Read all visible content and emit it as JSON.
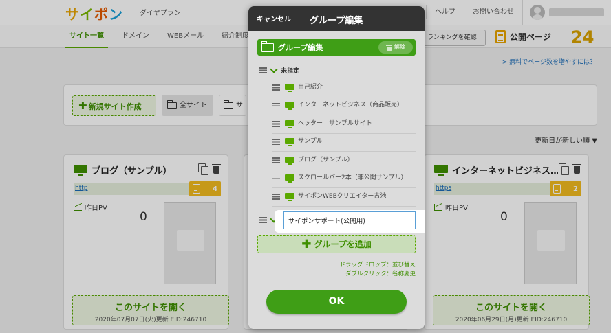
{
  "header": {
    "logo": [
      "サ",
      "イ",
      "ポ",
      "ン"
    ],
    "plan": "ダイヤプラン",
    "links": [
      "ヘルプ",
      "お問い合わせ"
    ]
  },
  "nav": {
    "tabs": [
      "サイト一覧",
      "ドメイン",
      "WEBメール",
      "紹介制度"
    ],
    "ranking_button": "ランキングを確認",
    "public_pages_label": "公開ページ",
    "public_pages_count": "24",
    "more_pages_link": "> 無料でページ数を増やすには？"
  },
  "toolbar": {
    "new_site": "新規サイト作成",
    "all_sites": "全サイト",
    "other": "サ"
  },
  "sort_label": "更新日が新しい順 ▼",
  "cards": [
    {
      "title": "ブログ（サンプル）",
      "url": "http",
      "pages": "4",
      "pv_label": "昨日PV",
      "pv": "0",
      "open_label": "このサイトを開く",
      "updated": "2020年07月07日(火)更新 EID:246710"
    },
    {
      "title": "インターネットビジネス…",
      "url": "https",
      "pages": "2",
      "pv_label": "昨日PV",
      "pv": "0",
      "open_label": "このサイトを開く",
      "updated": "2020年06月29日(月)更新 EID:246710"
    }
  ],
  "modal": {
    "cancel": "キャンセル",
    "title": "グループ編集",
    "group_header": "グループ編集",
    "release": "解除",
    "unassigned_group": "未指定",
    "sites": [
      "自己紹介",
      "インターネットビジネス（商品販売）",
      "ヘッター　サンプルサイト",
      "サンプル",
      "ブログ（サンプル）",
      "スクロールバー2本（非公開サンプル）",
      "サイポンWEBクリエイター古池"
    ],
    "new_group_value": "サイポンサポート(公開用)",
    "add_group": "グループを追加",
    "hint_drag": "ドラッグドロップ：並び替え",
    "hint_dblclick": "ダブルクリック：名称変更",
    "ok": "OK"
  }
}
